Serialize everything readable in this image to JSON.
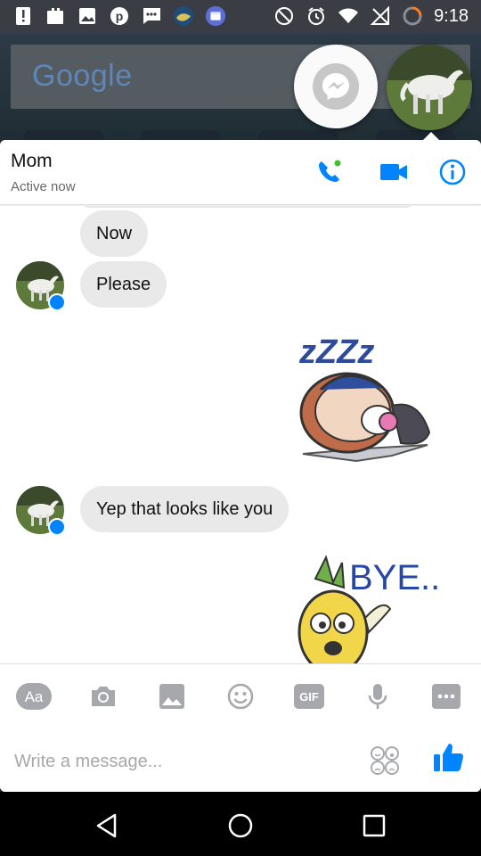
{
  "status_bar": {
    "time": "9:18",
    "left_icons": [
      "alert-icon",
      "clipboard-icon",
      "image-icon",
      "pinterest-icon",
      "message-icon",
      "weather-icon",
      "calendar-icon"
    ],
    "right_icons": [
      "dnd-icon",
      "alarm-icon",
      "wifi-icon",
      "no-signal-icon",
      "battery-ring-icon"
    ]
  },
  "home": {
    "google_label": "Google"
  },
  "chat": {
    "contact_name": "Mom",
    "contact_status": "Active now",
    "accent_color": "#0084ff",
    "messages": [
      {
        "text": "Now"
      },
      {
        "text": "Please"
      },
      {
        "text": "Yep that looks like you"
      }
    ],
    "sticker_zzzz_text": "zZZz",
    "sticker_bye_text": "BYE..."
  },
  "toolbar": {
    "aa_label": "Aa",
    "gif_label": "GIF"
  },
  "composer": {
    "placeholder": "Write a message..."
  }
}
